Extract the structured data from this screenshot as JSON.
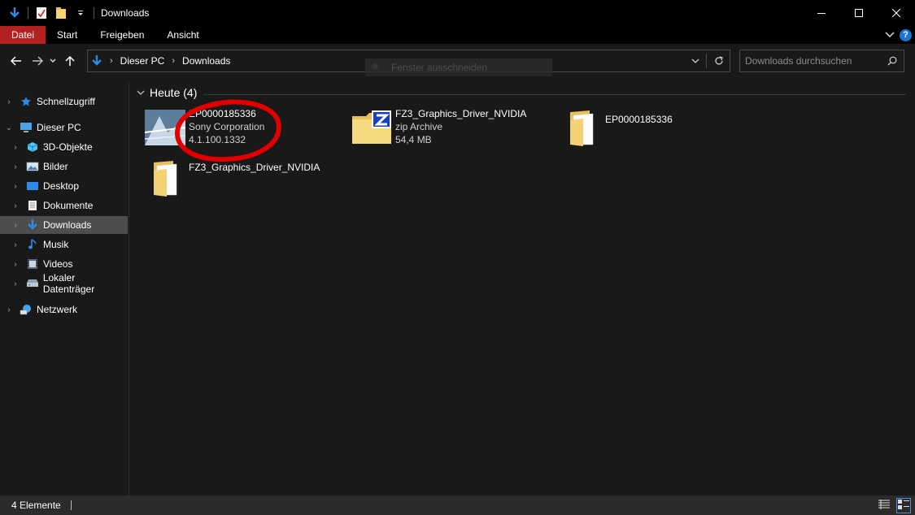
{
  "window": {
    "title": "Downloads"
  },
  "ribbon": {
    "tabs": [
      {
        "label": "Datei"
      },
      {
        "label": "Start"
      },
      {
        "label": "Freigeben"
      },
      {
        "label": "Ansicht"
      }
    ]
  },
  "address": {
    "crumbs": [
      "Dieser PC",
      "Downloads"
    ]
  },
  "search": {
    "placeholder": "Downloads durchsuchen"
  },
  "tooltip": {
    "text": "Fenster ausschneiden"
  },
  "navpane": {
    "items": [
      {
        "label": "Schnellzugriff",
        "icon": "star-icon"
      },
      {
        "label": "Dieser PC",
        "icon": "pc-icon"
      },
      {
        "label": "3D-Objekte",
        "icon": "cube-icon"
      },
      {
        "label": "Bilder",
        "icon": "pictures-icon"
      },
      {
        "label": "Desktop",
        "icon": "desktop-icon"
      },
      {
        "label": "Dokumente",
        "icon": "document-icon"
      },
      {
        "label": "Downloads",
        "icon": "download-icon",
        "selected": true
      },
      {
        "label": "Musik",
        "icon": "music-icon"
      },
      {
        "label": "Videos",
        "icon": "video-icon"
      },
      {
        "label": "Lokaler Datenträger",
        "icon": "drive-icon"
      },
      {
        "label": "Netzwerk",
        "icon": "network-icon"
      }
    ]
  },
  "content": {
    "group_label": "Heute (4)",
    "files": [
      {
        "name": "EP0000185336",
        "line2": "Sony Corporation",
        "line3": "4.1.100.1332",
        "icon": "installer-icon"
      },
      {
        "name": "FZ3_Graphics_Driver_NVIDIA",
        "line2": "zip Archive",
        "line3": "54,4 MB",
        "icon": "zip-folder-icon"
      },
      {
        "name": "EP0000185336",
        "icon": "folder-icon"
      },
      {
        "name": "FZ3_Graphics_Driver_NVIDIA",
        "icon": "folder-icon"
      }
    ]
  },
  "status": {
    "count": "4 Elemente"
  },
  "colors": {
    "accent_red": "#b52021",
    "selection": "#4d4d4d",
    "annotation": "#e00000"
  }
}
